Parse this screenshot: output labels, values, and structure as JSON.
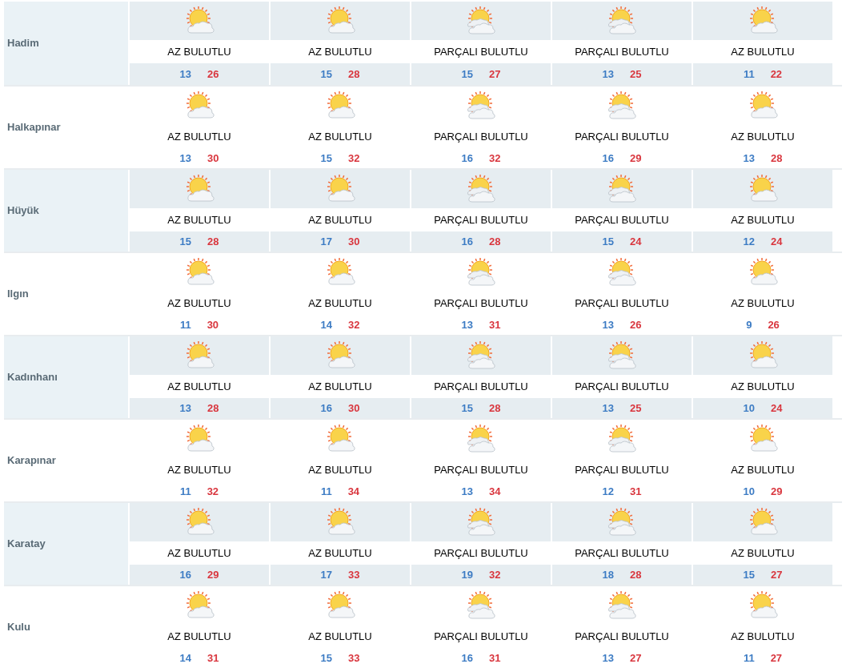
{
  "rows": [
    {
      "name": "Hadim",
      "days": [
        {
          "kind": "few",
          "condition": "AZ BULUTLU",
          "low": "13",
          "high": "26"
        },
        {
          "kind": "few",
          "condition": "AZ BULUTLU",
          "low": "15",
          "high": "28"
        },
        {
          "kind": "partly",
          "condition": "PARÇALI BULUTLU",
          "low": "15",
          "high": "27"
        },
        {
          "kind": "partly",
          "condition": "PARÇALI BULUTLU",
          "low": "13",
          "high": "25"
        },
        {
          "kind": "few",
          "condition": "AZ BULUTLU",
          "low": "11",
          "high": "22"
        }
      ]
    },
    {
      "name": "Halkapınar",
      "days": [
        {
          "kind": "few",
          "condition": "AZ BULUTLU",
          "low": "13",
          "high": "30"
        },
        {
          "kind": "few",
          "condition": "AZ BULUTLU",
          "low": "15",
          "high": "32"
        },
        {
          "kind": "partly",
          "condition": "PARÇALI BULUTLU",
          "low": "16",
          "high": "32"
        },
        {
          "kind": "partly",
          "condition": "PARÇALI BULUTLU",
          "low": "16",
          "high": "29"
        },
        {
          "kind": "few",
          "condition": "AZ BULUTLU",
          "low": "13",
          "high": "28"
        }
      ]
    },
    {
      "name": "Hüyük",
      "days": [
        {
          "kind": "few",
          "condition": "AZ BULUTLU",
          "low": "15",
          "high": "28"
        },
        {
          "kind": "few",
          "condition": "AZ BULUTLU",
          "low": "17",
          "high": "30"
        },
        {
          "kind": "partly",
          "condition": "PARÇALI BULUTLU",
          "low": "16",
          "high": "28"
        },
        {
          "kind": "partly",
          "condition": "PARÇALI BULUTLU",
          "low": "15",
          "high": "24"
        },
        {
          "kind": "few",
          "condition": "AZ BULUTLU",
          "low": "12",
          "high": "24"
        }
      ]
    },
    {
      "name": "Ilgın",
      "days": [
        {
          "kind": "few",
          "condition": "AZ BULUTLU",
          "low": "11",
          "high": "30"
        },
        {
          "kind": "few",
          "condition": "AZ BULUTLU",
          "low": "14",
          "high": "32"
        },
        {
          "kind": "partly",
          "condition": "PARÇALI BULUTLU",
          "low": "13",
          "high": "31"
        },
        {
          "kind": "partly",
          "condition": "PARÇALI BULUTLU",
          "low": "13",
          "high": "26"
        },
        {
          "kind": "few",
          "condition": "AZ BULUTLU",
          "low": "9",
          "high": "26"
        }
      ]
    },
    {
      "name": "Kadınhanı",
      "days": [
        {
          "kind": "few",
          "condition": "AZ BULUTLU",
          "low": "13",
          "high": "28"
        },
        {
          "kind": "few",
          "condition": "AZ BULUTLU",
          "low": "16",
          "high": "30"
        },
        {
          "kind": "partly",
          "condition": "PARÇALI BULUTLU",
          "low": "15",
          "high": "28"
        },
        {
          "kind": "partly",
          "condition": "PARÇALI BULUTLU",
          "low": "13",
          "high": "25"
        },
        {
          "kind": "few",
          "condition": "AZ BULUTLU",
          "low": "10",
          "high": "24"
        }
      ]
    },
    {
      "name": "Karapınar",
      "days": [
        {
          "kind": "few",
          "condition": "AZ BULUTLU",
          "low": "11",
          "high": "32"
        },
        {
          "kind": "few",
          "condition": "AZ BULUTLU",
          "low": "11",
          "high": "34"
        },
        {
          "kind": "partly",
          "condition": "PARÇALI BULUTLU",
          "low": "13",
          "high": "34"
        },
        {
          "kind": "partly",
          "condition": "PARÇALI BULUTLU",
          "low": "12",
          "high": "31"
        },
        {
          "kind": "few",
          "condition": "AZ BULUTLU",
          "low": "10",
          "high": "29"
        }
      ]
    },
    {
      "name": "Karatay",
      "days": [
        {
          "kind": "few",
          "condition": "AZ BULUTLU",
          "low": "16",
          "high": "29"
        },
        {
          "kind": "few",
          "condition": "AZ BULUTLU",
          "low": "17",
          "high": "33"
        },
        {
          "kind": "partly",
          "condition": "PARÇALI BULUTLU",
          "low": "19",
          "high": "32"
        },
        {
          "kind": "partly",
          "condition": "PARÇALI BULUTLU",
          "low": "18",
          "high": "28"
        },
        {
          "kind": "few",
          "condition": "AZ BULUTLU",
          "low": "15",
          "high": "27"
        }
      ]
    },
    {
      "name": "Kulu",
      "days": [
        {
          "kind": "few",
          "condition": "AZ BULUTLU",
          "low": "14",
          "high": "31"
        },
        {
          "kind": "few",
          "condition": "AZ BULUTLU",
          "low": "15",
          "high": "33"
        },
        {
          "kind": "partly",
          "condition": "PARÇALI BULUTLU",
          "low": "16",
          "high": "31"
        },
        {
          "kind": "partly",
          "condition": "PARÇALI BULUTLU",
          "low": "13",
          "high": "27"
        },
        {
          "kind": "few",
          "condition": "AZ BULUTLU",
          "low": "11",
          "high": "27"
        }
      ]
    }
  ]
}
